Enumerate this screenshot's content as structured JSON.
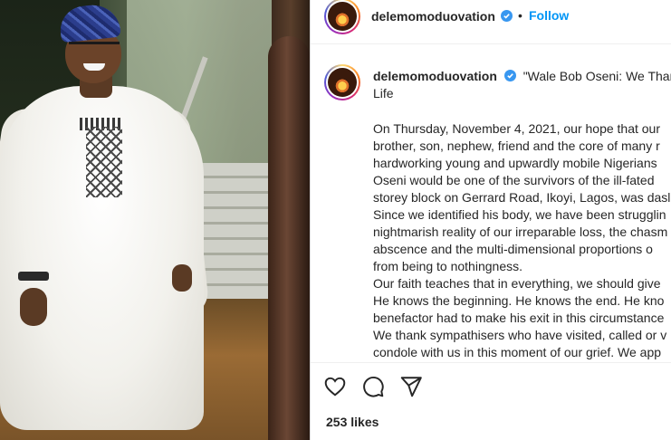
{
  "post": {
    "username": "delemomoduovation",
    "follow_label": "Follow",
    "separator": "•",
    "headline": "\"Wale Bob Oseni: We Than",
    "headline_cont": "Life",
    "caption_lines": [
      "On Thursday, November 4, 2021, our hope that our",
      "brother, son, nephew, friend and the core of many r",
      "hardworking young and upwardly mobile Nigerians",
      "Oseni would be one of the survivors of the ill-fated",
      "storey block on Gerrard Road, Ikoyi, Lagos, was dasl",
      "Since we identified his body, we have been strugglin",
      "nightmarish reality of our irreparable loss, the chasm",
      "abscence and the multi-dimensional proportions o",
      "from being to nothingness.",
      "Our faith teaches that in everything, we should give",
      "He knows the beginning. He knows the end. He kno",
      "benefactor had to make his exit in this circumstance",
      "We thank sympathisers who have visited, called or v",
      "condole with us in this moment of our grief. We app"
    ],
    "likes": "253 likes",
    "icons": {
      "verified": "verified-badge-icon",
      "like": "heart-icon",
      "comment": "comment-bubble-icon",
      "share": "paper-plane-icon"
    },
    "colors": {
      "accent": "#0095f6",
      "verified": "#3897f0",
      "text": "#262626"
    }
  }
}
